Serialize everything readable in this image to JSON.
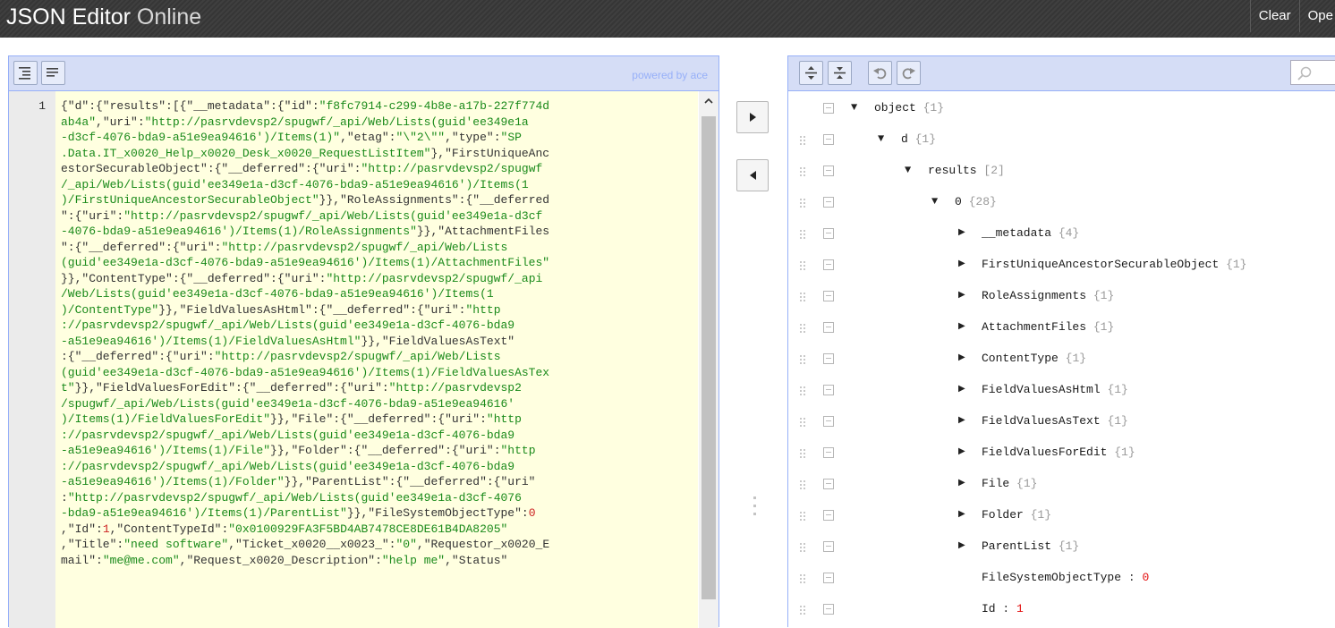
{
  "header": {
    "logo_part1": "JSON Editor",
    "logo_part2": " Online",
    "menu": [
      "Clear",
      "Ope"
    ]
  },
  "left_panel": {
    "powered_by": "powered by ace",
    "line_number": "1",
    "code_lines": [
      [
        [
          "p",
          "{\"d\":{\"results\":[{\"__metadata\":{\"id\":"
        ],
        [
          "s",
          "\"f8fc7914-c299-4b8e-a17b-227f774d"
        ]
      ],
      [
        [
          "s",
          "ab4a\""
        ],
        [
          "p",
          ",\"uri\":"
        ],
        [
          "s",
          "\"http://pasrvdevsp2/spugwf/_api/Web/Lists(guid'ee349e1a"
        ]
      ],
      [
        [
          "s",
          "-d3cf-4076-bda9-a51e9ea94616')/Items(1)\""
        ],
        [
          "p",
          ",\"etag\":"
        ],
        [
          "s",
          "\"\\\"2\\\"\""
        ],
        [
          "p",
          ",\"type\":"
        ],
        [
          "s",
          "\"SP"
        ]
      ],
      [
        [
          "s",
          ".Data.IT_x0020_Help_x0020_Desk_x0020_RequestListItem\""
        ],
        [
          "p",
          "},\"FirstUniqueAnc"
        ]
      ],
      [
        [
          "p",
          "estorSecurableObject\":{\"__deferred\":{\"uri\":"
        ],
        [
          "s",
          "\"http://pasrvdevsp2/spugwf"
        ]
      ],
      [
        [
          "s",
          "/_api/Web/Lists(guid'ee349e1a-d3cf-4076-bda9-a51e9ea94616')/Items(1"
        ]
      ],
      [
        [
          "s",
          ")/FirstUniqueAncestorSecurableObject\""
        ],
        [
          "p",
          "}},\"RoleAssignments\":{\"__deferred"
        ]
      ],
      [
        [
          "p",
          "\":{\"uri\":"
        ],
        [
          "s",
          "\"http://pasrvdevsp2/spugwf/_api/Web/Lists(guid'ee349e1a-d3cf"
        ]
      ],
      [
        [
          "s",
          "-4076-bda9-a51e9ea94616')/Items(1)/RoleAssignments\""
        ],
        [
          "p",
          "}},\"AttachmentFiles"
        ]
      ],
      [
        [
          "p",
          "\":{\"__deferred\":{\"uri\":"
        ],
        [
          "s",
          "\"http://pasrvdevsp2/spugwf/_api/Web/Lists"
        ]
      ],
      [
        [
          "s",
          "(guid'ee349e1a-d3cf-4076-bda9-a51e9ea94616')/Items(1)/AttachmentFiles\""
        ]
      ],
      [
        [
          "p",
          "}},\"ContentType\":{\"__deferred\":{\"uri\":"
        ],
        [
          "s",
          "\"http://pasrvdevsp2/spugwf/_api"
        ]
      ],
      [
        [
          "s",
          "/Web/Lists(guid'ee349e1a-d3cf-4076-bda9-a51e9ea94616')/Items(1"
        ]
      ],
      [
        [
          "s",
          ")/ContentType\""
        ],
        [
          "p",
          "}},\"FieldValuesAsHtml\":{\"__deferred\":{\"uri\":"
        ],
        [
          "s",
          "\"http"
        ]
      ],
      [
        [
          "s",
          "://pasrvdevsp2/spugwf/_api/Web/Lists(guid'ee349e1a-d3cf-4076-bda9"
        ]
      ],
      [
        [
          "s",
          "-a51e9ea94616')/Items(1)/FieldValuesAsHtml\""
        ],
        [
          "p",
          "}},\"FieldValuesAsText\""
        ]
      ],
      [
        [
          "p",
          ":{\"__deferred\":{\"uri\":"
        ],
        [
          "s",
          "\"http://pasrvdevsp2/spugwf/_api/Web/Lists"
        ]
      ],
      [
        [
          "s",
          "(guid'ee349e1a-d3cf-4076-bda9-a51e9ea94616')/Items(1)/FieldValuesAsTex"
        ]
      ],
      [
        [
          "s",
          "t\""
        ],
        [
          "p",
          "}},\"FieldValuesForEdit\":{\"__deferred\":{\"uri\":"
        ],
        [
          "s",
          "\"http://pasrvdevsp2"
        ]
      ],
      [
        [
          "s",
          "/spugwf/_api/Web/Lists(guid'ee349e1a-d3cf-4076-bda9-a51e9ea94616'"
        ]
      ],
      [
        [
          "s",
          ")/Items(1)/FieldValuesForEdit\""
        ],
        [
          "p",
          "}},\"File\":{\"__deferred\":{\"uri\":"
        ],
        [
          "s",
          "\"http"
        ]
      ],
      [
        [
          "s",
          "://pasrvdevsp2/spugwf/_api/Web/Lists(guid'ee349e1a-d3cf-4076-bda9"
        ]
      ],
      [
        [
          "s",
          "-a51e9ea94616')/Items(1)/File\""
        ],
        [
          "p",
          "}},\"Folder\":{\"__deferred\":{\"uri\":"
        ],
        [
          "s",
          "\"http"
        ]
      ],
      [
        [
          "s",
          "://pasrvdevsp2/spugwf/_api/Web/Lists(guid'ee349e1a-d3cf-4076-bda9"
        ]
      ],
      [
        [
          "s",
          "-a51e9ea94616')/Items(1)/Folder\""
        ],
        [
          "p",
          "}},\"ParentList\":{\"__deferred\":{\"uri\""
        ]
      ],
      [
        [
          "p",
          ":"
        ],
        [
          "s",
          "\"http://pasrvdevsp2/spugwf/_api/Web/Lists(guid'ee349e1a-d3cf-4076"
        ]
      ],
      [
        [
          "s",
          "-bda9-a51e9ea94616')/Items(1)/ParentList\""
        ],
        [
          "p",
          "}},\"FileSystemObjectType\":"
        ],
        [
          "n",
          "0"
        ]
      ],
      [
        [
          "p",
          ",\"Id\":"
        ],
        [
          "n",
          "1"
        ],
        [
          "p",
          ",\"ContentTypeId\":"
        ],
        [
          "s",
          "\"0x0100929FA3F5BD4AB7478CE8DE61B4DA8205\""
        ]
      ],
      [
        [
          "p",
          ",\"Title\":"
        ],
        [
          "s",
          "\"need software\""
        ],
        [
          "p",
          ",\"Ticket_x0020__x0023_\":"
        ],
        [
          "s",
          "\"0\""
        ],
        [
          "p",
          ",\"Requestor_x0020_E"
        ]
      ],
      [
        [
          "p",
          "mail\":"
        ],
        [
          "s",
          "\"me@me.com\""
        ],
        [
          "p",
          ",\"Request_x0020_Description\":"
        ],
        [
          "s",
          "\"help me\""
        ],
        [
          "p",
          ",\"Status\""
        ]
      ]
    ]
  },
  "tree": {
    "rows": [
      {
        "key": "object",
        "count": "{1}",
        "arrow": "down",
        "indent": 0
      },
      {
        "key": "d",
        "count": "{1}",
        "arrow": "down",
        "indent": 1,
        "gap": "   "
      },
      {
        "key": "results",
        "count": "[2]",
        "arrow": "down",
        "indent": 2
      },
      {
        "key": "0",
        "count": "{28}",
        "arrow": "down",
        "indent": 3
      },
      {
        "key": "__metadata",
        "count": "{4}",
        "arrow": "right",
        "indent": 4
      },
      {
        "key": "FirstUniqueAncestorSecurableObject",
        "count": "{1}",
        "arrow": "right",
        "indent": 4
      },
      {
        "key": "RoleAssignments",
        "count": "{1}",
        "arrow": "right",
        "indent": 4
      },
      {
        "key": "AttachmentFiles",
        "count": "{1}",
        "arrow": "right",
        "indent": 4
      },
      {
        "key": "ContentType",
        "count": "{1}",
        "arrow": "right",
        "indent": 4
      },
      {
        "key": "FieldValuesAsHtml",
        "count": "{1}",
        "arrow": "right",
        "indent": 4
      },
      {
        "key": "FieldValuesAsText",
        "count": "{1}",
        "arrow": "right",
        "indent": 4
      },
      {
        "key": "FieldValuesForEdit",
        "count": "{1}",
        "arrow": "right",
        "indent": 4
      },
      {
        "key": "File",
        "count": "{1}",
        "arrow": "right",
        "indent": 4
      },
      {
        "key": "Folder",
        "count": "{1}",
        "arrow": "right",
        "indent": 4
      },
      {
        "key": "ParentList",
        "count": "{1}",
        "arrow": "right",
        "indent": 4
      },
      {
        "key": "FileSystemObjectType",
        "value": "0",
        "indent": 4
      },
      {
        "key": "Id",
        "value": "1",
        "indent": 4,
        "pad": "  "
      }
    ]
  },
  "icons": {
    "format": "format-icon",
    "compact": "compact-icon",
    "expand_all": "expand-all-icon",
    "collapse_all": "collapse-all-icon",
    "undo": "undo-icon",
    "redo": "redo-icon",
    "search": "search-icon",
    "copy_right": "arrow-right-icon",
    "copy_left": "arrow-left-icon"
  },
  "colors": {
    "toolbar": "#d5ddf6",
    "border": "#97b0f8",
    "editor_bg": "#ffffe0",
    "string": "#1a8a1a",
    "number": "#cc2222",
    "header": "#3c3c3c"
  }
}
